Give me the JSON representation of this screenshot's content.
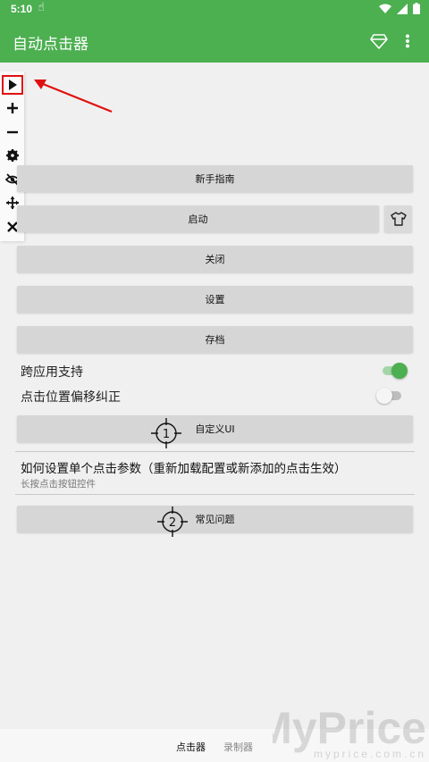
{
  "status": {
    "time": "5:10"
  },
  "app": {
    "title": "自动点击器"
  },
  "toolbar": {
    "items": [
      "play-icon",
      "plus-icon",
      "minus-icon",
      "gear-icon",
      "eye-off-icon",
      "move-icon",
      "close-icon"
    ]
  },
  "buttons": {
    "guide": "新手指南",
    "start": "启动",
    "close": "关闭",
    "settings": "设置",
    "archive": "存档",
    "custom_ui": "自定义UI",
    "faq": "常见问题"
  },
  "toggles": {
    "cross_app": {
      "label": "跨应用支持",
      "on": true
    },
    "offset_fix": {
      "label": "点击位置偏移纠正",
      "on": false
    }
  },
  "info": {
    "title": "如何设置单个点击参数（重新加载配置或新添加的点击生效）",
    "subtitle": "长按点击按钮控件"
  },
  "markers": {
    "custom_ui": "1",
    "faq": "2"
  },
  "bottom_nav": {
    "tab1": "点击器",
    "tab2": "录制器"
  },
  "watermark": {
    "brand": "MyPrice",
    "url": "myprice.com.cn"
  },
  "colors": {
    "accent": "#4caf50",
    "highlight": "#e01010"
  }
}
